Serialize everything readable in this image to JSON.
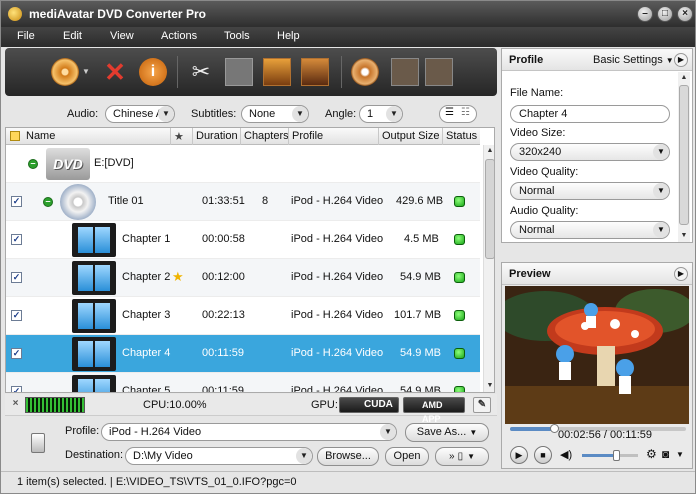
{
  "app": {
    "title": "mediAvatar DVD Converter Pro"
  },
  "menu": [
    "File",
    "Edit",
    "View",
    "Actions",
    "Tools",
    "Help"
  ],
  "filters": {
    "audio_label": "Audio:",
    "audio_value": "Chinese AC",
    "subtitles_label": "Subtitles:",
    "subtitles_value": "None",
    "angle_label": "Angle:",
    "angle_value": "1"
  },
  "table": {
    "headers": [
      "Name",
      "★",
      "Duration",
      "Chapters",
      "Profile",
      "Output Size",
      "Status"
    ],
    "source": {
      "drive": "E:[DVD]"
    },
    "rows": [
      {
        "name": "Title 01",
        "duration": "01:33:51",
        "chapters": "8",
        "profile": "iPod - H.264 Video",
        "size": "429.6 MB",
        "checked": "✓"
      },
      {
        "name": "Chapter 1",
        "duration": "00:00:58",
        "chapters": "",
        "profile": "iPod - H.264 Video",
        "size": "4.5 MB",
        "checked": "✓"
      },
      {
        "name": "Chapter 2",
        "duration": "00:12:00",
        "chapters": "",
        "profile": "iPod - H.264 Video",
        "size": "54.9 MB",
        "checked": "✓",
        "star": "★"
      },
      {
        "name": "Chapter 3",
        "duration": "00:22:13",
        "chapters": "",
        "profile": "iPod - H.264 Video",
        "size": "101.7 MB",
        "checked": "✓"
      },
      {
        "name": "Chapter 4",
        "duration": "00:11:59",
        "chapters": "",
        "profile": "iPod - H.264 Video",
        "size": "54.9 MB",
        "checked": "✓"
      },
      {
        "name": "Chapter 5",
        "duration": "00:11:59",
        "chapters": "",
        "profile": "iPod - H.264 Video",
        "size": "54.9 MB",
        "checked": "✓"
      }
    ]
  },
  "perf": {
    "cpu": "CPU:10.00%",
    "gpu_label": "GPU:",
    "cuda": "CUDA",
    "amd": "AMD APP"
  },
  "output": {
    "profile_label": "Profile:",
    "profile_value": "iPod - H.264 Video",
    "save_as": "Save As...",
    "destination_label": "Destination:",
    "destination_value": "D:\\My Video",
    "browse": "Browse...",
    "open": "Open"
  },
  "status_text": "1 item(s) selected. | E:\\VIDEO_TS\\VTS_01_0.IFO?pgc=0",
  "profile_panel": {
    "title": "Profile",
    "settings": "Basic Settings",
    "file_name_label": "File Name:",
    "file_name": "Chapter 4",
    "video_size_label": "Video Size:",
    "video_size": "320x240",
    "video_quality_label": "Video Quality:",
    "video_quality": "Normal",
    "audio_quality_label": "Audio Quality:",
    "audio_quality": "Normal"
  },
  "preview": {
    "title": "Preview",
    "time": "00:02:56 / 00:11:59",
    "progress": 0.25,
    "volume": 0.6
  },
  "colors": {
    "accent": "#3aa6dd",
    "status_ok": "#1aa619"
  }
}
